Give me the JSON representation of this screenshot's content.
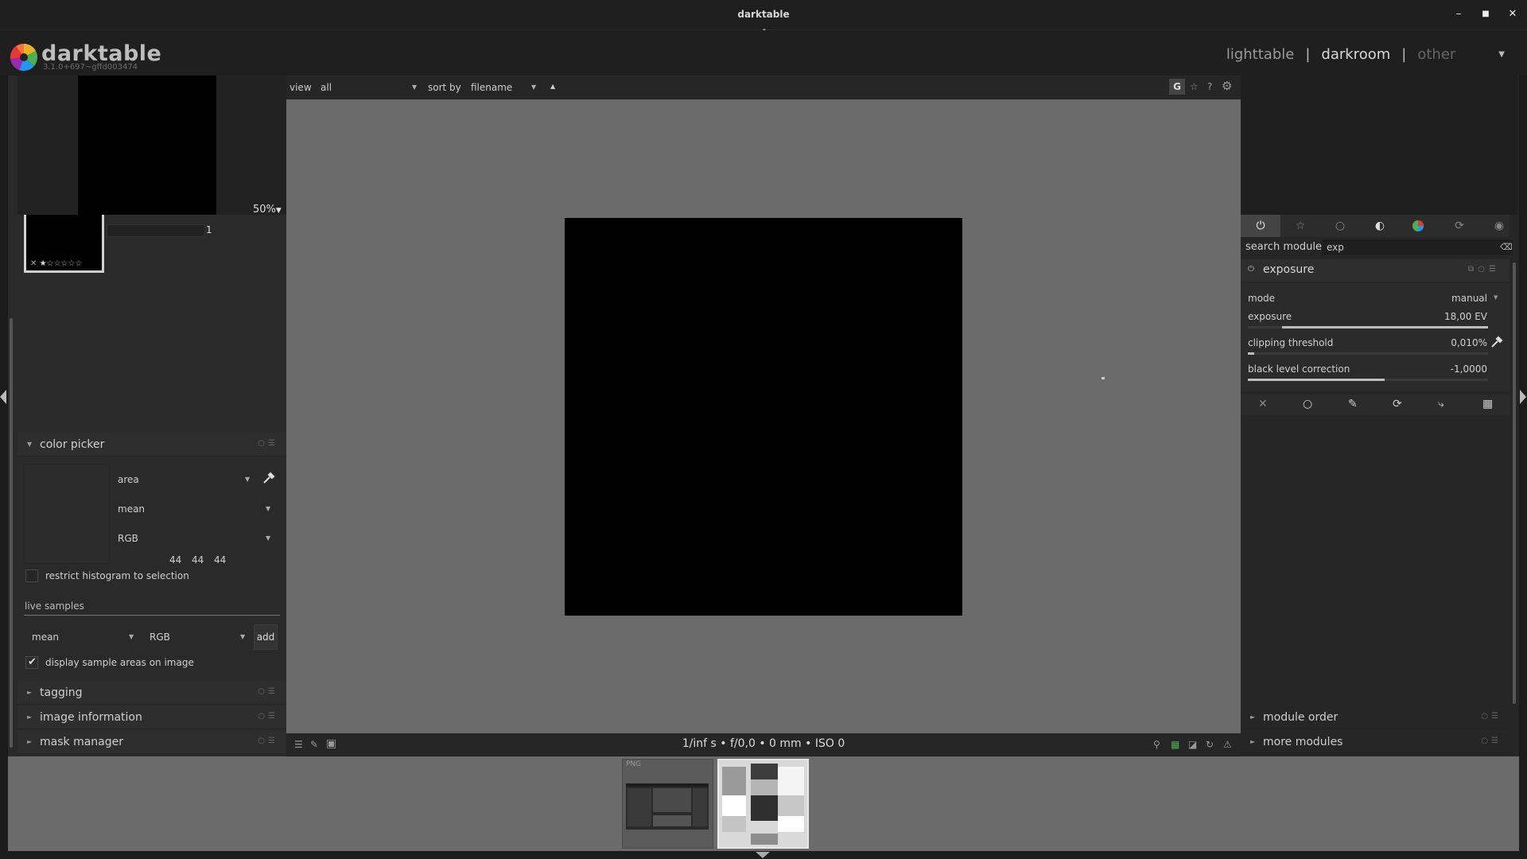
{
  "window": {
    "title": "darktable"
  },
  "app": {
    "name": "darktable",
    "version": "3.1.0+697~gffd003474"
  },
  "views": {
    "lighttable": "lighttable",
    "darkroom": "darkroom",
    "other": "other",
    "separator": "|"
  },
  "navigator": {
    "zoom": "50%"
  },
  "snapshot": {
    "number": "1",
    "stars": "☆☆☆☆☆"
  },
  "top_toolbar": {
    "view_label": "view",
    "view_value": "all",
    "sort_label": "sort by",
    "sort_value": "filename",
    "g_label": "G"
  },
  "left_modules": {
    "color_picker": {
      "title": "color picker",
      "area": "area",
      "statistic": "mean",
      "color_mode": "RGB",
      "values": [
        "44",
        "44",
        "44"
      ],
      "restrict_label": "restrict histogram to selection",
      "restrict_checked": false,
      "live_samples_label": "live samples",
      "sample_statistic": "mean",
      "sample_mode": "RGB",
      "add_label": "add",
      "display_samples_label": "display sample areas on image",
      "display_samples_checked": true
    },
    "tagging": {
      "title": "tagging"
    },
    "image_information": {
      "title": "image information"
    },
    "mask_manager": {
      "title": "mask manager"
    }
  },
  "exif": "1/inf s • f/0,0 • 0 mm • ISO 0",
  "right_panel": {
    "search_label": "search module",
    "search_value": "exp",
    "exposure": {
      "title": "exposure",
      "mode_label": "mode",
      "mode_value": "manual",
      "exposure_label": "exposure",
      "exposure_value": "18,00 EV",
      "clipping_label": "clipping threshold",
      "clipping_value": "0,010%",
      "black_label": "black level correction",
      "black_value": "-1,0000"
    },
    "module_order": "module order",
    "more_modules": "more modules"
  },
  "filmstrip": {
    "first_label": "PNG"
  },
  "colors": {
    "panel": "#2a2a2a",
    "center": "#6b6b6b",
    "accent": "#d8d8d8"
  }
}
